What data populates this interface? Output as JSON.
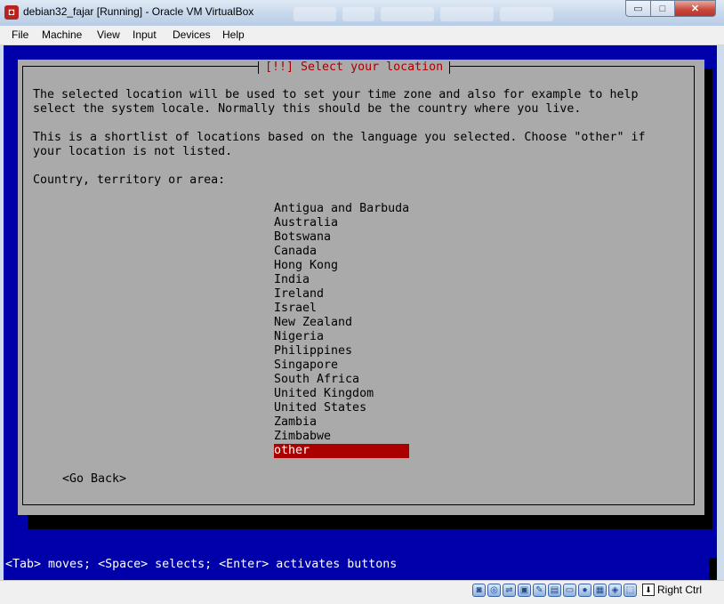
{
  "window": {
    "title": "debian32_fajar [Running] - Oracle VM VirtualBox",
    "min_symbol": "▭",
    "max_symbol": "□",
    "close_symbol": "✕"
  },
  "menu": [
    "File",
    "Machine",
    "View",
    "Input",
    "Devices",
    "Help"
  ],
  "installer": {
    "dialog_title": "[!!] Select your location",
    "paragraph1": "The selected location will be used to set your time zone and also for example to help\nselect the system locale. Normally this should be the country where you live.",
    "paragraph2": "This is a shortlist of locations based on the language you selected. Choose \"other\" if\nyour location is not listed.",
    "prompt": "Country, territory or area:",
    "countries": [
      "Antigua and Barbuda",
      "Australia",
      "Botswana",
      "Canada",
      "Hong Kong",
      "India",
      "Ireland",
      "Israel",
      "New Zealand",
      "Nigeria",
      "Philippines",
      "Singapore",
      "South Africa",
      "United Kingdom",
      "United States",
      "Zambia",
      "Zimbabwe",
      "other"
    ],
    "selected": "other",
    "go_back": "<Go Back>",
    "status_line": "<Tab> moves; <Space> selects; <Enter> activates buttons"
  },
  "statusbar": {
    "icons": [
      "hard-disk-icon",
      "optical-drive-icon",
      "usb-icon",
      "network-icon",
      "pencil-icon",
      "folder-icon",
      "display-icon",
      "video-capture-icon",
      "cpu-icon",
      "virtualization-icon",
      "mouse-integration-icon"
    ],
    "host_key_arrow": "⬇",
    "host_key": "Right Ctrl"
  },
  "colors": {
    "screen_bg": "#0000aa",
    "dialog_bg": "#aaaaaa",
    "title_text": "#aa0000",
    "selection_bg": "#aa0000"
  }
}
